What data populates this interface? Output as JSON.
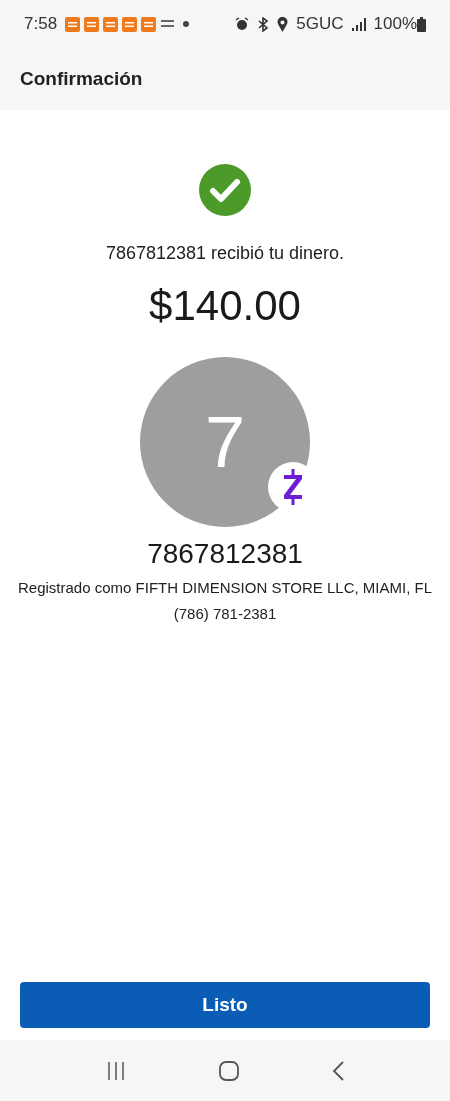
{
  "status_bar": {
    "time": "7:58",
    "notifications": [
      {
        "kind": "badge"
      },
      {
        "kind": "badge"
      },
      {
        "kind": "badge"
      },
      {
        "kind": "badge"
      },
      {
        "kind": "badge"
      },
      {
        "kind": "plain"
      }
    ],
    "network": "5GUC",
    "battery": "100%"
  },
  "header": {
    "title": "Confirmación"
  },
  "confirmation": {
    "message": "7867812381 recibió tu dinero.",
    "amount": "$140.00"
  },
  "recipient": {
    "initial": "7",
    "name": "7867812381",
    "registered": "Registrado como FIFTH DIMENSION STORE LLC, MIAMI, FL",
    "phone": "(786) 781-2381"
  },
  "done_button": "Listo"
}
